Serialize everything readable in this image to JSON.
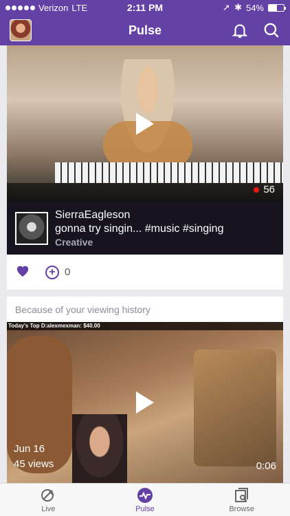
{
  "status_bar": {
    "carrier": "Verizon",
    "network": "LTE",
    "time": "2:11 PM",
    "battery": "54%",
    "battery_level": 0.54
  },
  "header": {
    "title": "Pulse",
    "bell_icon": "bell-icon",
    "search_icon": "search-icon"
  },
  "feed": {
    "card1": {
      "viewers": "56",
      "channel_name": "SierraEagleson",
      "stream_title": "gonna try singin... #music #singing",
      "game": "Creative",
      "follow_count": "0"
    },
    "card2": {
      "reason": "Because of your viewing history",
      "overlay_top": "Today's Top D:alexmexman: $40.00",
      "date": "Jun 16",
      "views": "45 views",
      "duration": "0:06"
    }
  },
  "tabs": [
    {
      "label": "Live",
      "icon": "live-icon"
    },
    {
      "label": "Pulse",
      "icon": "pulse-icon"
    },
    {
      "label": "Browse",
      "icon": "browse-icon"
    }
  ],
  "colors": {
    "brand": "#6441a4",
    "live_dot": "#e91916"
  }
}
